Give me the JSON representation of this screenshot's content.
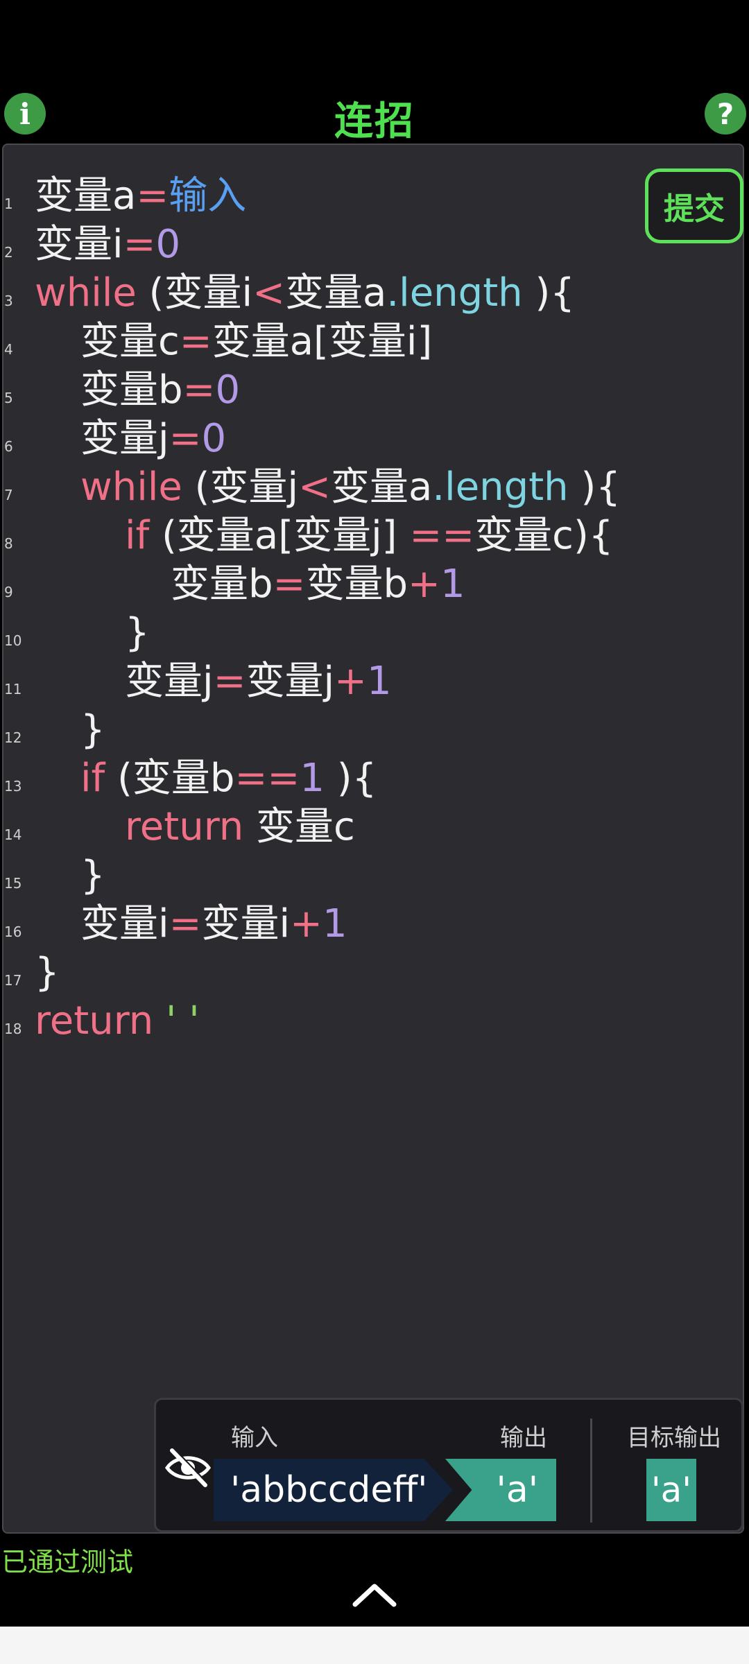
{
  "header": {
    "title": "连招",
    "info_icon": "i",
    "help_icon": "?"
  },
  "editor": {
    "submit_label": "提交",
    "lines": [
      {
        "n": "1"
      },
      {
        "n": "2"
      },
      {
        "n": "3"
      },
      {
        "n": "4"
      },
      {
        "n": "5"
      },
      {
        "n": "6"
      },
      {
        "n": "7"
      },
      {
        "n": "8"
      },
      {
        "n": "9"
      },
      {
        "n": "10"
      },
      {
        "n": "11"
      },
      {
        "n": "12"
      },
      {
        "n": "13"
      },
      {
        "n": "14"
      },
      {
        "n": "15"
      },
      {
        "n": "16"
      },
      {
        "n": "17"
      },
      {
        "n": "18"
      }
    ],
    "tokens": {
      "l1": [
        "变量a",
        "=",
        "输入"
      ],
      "l2": [
        "变量i",
        "=",
        "0"
      ],
      "l3": [
        "while",
        " (变量i",
        "<",
        "变量a",
        ".length",
        " ){"
      ],
      "l4": [
        "变量c",
        "=",
        "变量a[变量i]"
      ],
      "l5": [
        "变量b",
        "=",
        "0"
      ],
      "l6": [
        "变量j",
        "=",
        "0"
      ],
      "l7": [
        "while",
        " (变量j",
        "<",
        "变量a",
        ".length",
        " ){"
      ],
      "l8": [
        "if",
        " (变量a[变量j] ",
        "==",
        "变量c){"
      ],
      "l9": [
        "变量b",
        "=",
        "变量b",
        "+",
        "1"
      ],
      "l10": [
        "}"
      ],
      "l11": [
        "变量j",
        "=",
        "变量j",
        "+",
        "1"
      ],
      "l12": [
        "}"
      ],
      "l13": [
        "if",
        " (变量b",
        "==",
        "1",
        " ){"
      ],
      "l14": [
        "return",
        " 变量c"
      ],
      "l15": [
        "}"
      ],
      "l16": [
        "变量i",
        "=",
        "变量i",
        "+",
        "1"
      ],
      "l17": [
        "}"
      ],
      "l18": [
        "return",
        " ' '"
      ]
    }
  },
  "io": {
    "input_label": "输入",
    "output_label": "输出",
    "target_label": "目标输出",
    "input_value": "'abbccdeff'",
    "output_value": "'a'",
    "target_value": "'a'",
    "eye_icon": "eye-off"
  },
  "status": {
    "text": "已通过测试"
  },
  "colors": {
    "title": "#4fe04f",
    "keyword": "#f07088",
    "number": "#b39ae6",
    "property": "#7fd4e2",
    "input_keyword": "#5aa0f2",
    "string": "#8fd068",
    "pass": "#7fe04a",
    "chip_output": "#3aa28a",
    "chip_input": "#11223a"
  }
}
